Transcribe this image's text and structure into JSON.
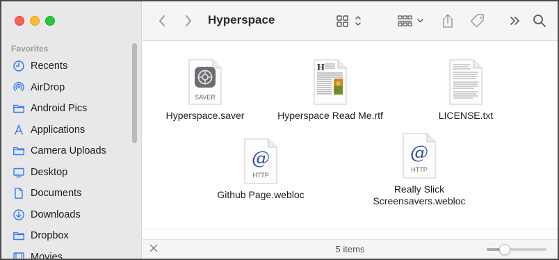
{
  "window": {
    "title": "Hyperspace",
    "traffic_lights": [
      "close",
      "minimize",
      "zoom"
    ]
  },
  "sidebar": {
    "section_header": "Favorites",
    "items": [
      {
        "label": "Recents",
        "icon": "clock-icon"
      },
      {
        "label": "AirDrop",
        "icon": "airdrop-icon"
      },
      {
        "label": "Android Pics",
        "icon": "folder-icon"
      },
      {
        "label": "Applications",
        "icon": "applications-icon"
      },
      {
        "label": "Camera Uploads",
        "icon": "folder-icon"
      },
      {
        "label": "Desktop",
        "icon": "desktop-icon"
      },
      {
        "label": "Documents",
        "icon": "document-icon"
      },
      {
        "label": "Downloads",
        "icon": "download-icon"
      },
      {
        "label": "Dropbox",
        "icon": "folder-icon"
      },
      {
        "label": "Movies",
        "icon": "film-icon"
      }
    ]
  },
  "toolbar": {
    "back_icon": "chevron-left-icon",
    "forward_icon": "chevron-right-icon",
    "view_icon": "icon-grid-view-icon",
    "group_icon": "group-by-icon",
    "share_icon": "share-icon",
    "tag_icon": "tag-icon",
    "more_icon": "chevrons-right-icon",
    "search_icon": "search-icon"
  },
  "files": [
    {
      "name": "Hyperspace.saver",
      "kind": "saver",
      "badge": "SAVER"
    },
    {
      "name": "Hyperspace Read Me.rtf",
      "kind": "rtf",
      "badge": "H"
    },
    {
      "name": "LICENSE.txt",
      "kind": "txt",
      "badge": ""
    },
    {
      "name": "Github Page.webloc",
      "kind": "webloc",
      "badge": "HTTP"
    },
    {
      "name": "Really Slick\nScreensavers.webloc",
      "name_line1": "Really Slick",
      "name_line2": "Screensavers.webloc",
      "kind": "webloc",
      "badge": "HTTP"
    }
  ],
  "status": {
    "item_count": "5 items",
    "zoom_level": 0.25
  },
  "colors": {
    "accent": "#2e7cf6",
    "sidebar_bg": "#e9e8e8",
    "close": "#fe5f57",
    "minimize": "#febc2e",
    "zoom": "#28c840"
  }
}
